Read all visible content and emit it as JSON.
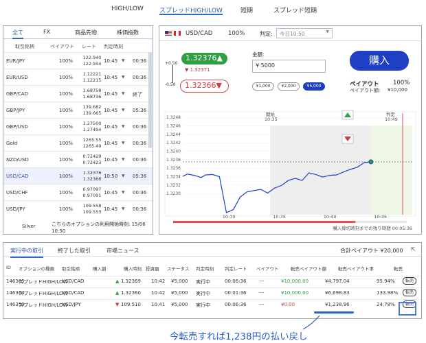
{
  "top_tabs": [
    "HIGH/LOW",
    "スプレッドHIGH/LOW",
    "短期",
    "スプレッド短期"
  ],
  "left": {
    "category_tabs": [
      "全て",
      "FX",
      "商品先物",
      "株価指数"
    ],
    "headers": [
      "取引銘柄",
      "ペイアウト",
      "レート",
      "判定時刻"
    ],
    "rows": [
      {
        "pair": "EUR/JPY",
        "payout": "100%",
        "rate_hi": "122.940",
        "rate_lo": "122.934",
        "judge": "10:45",
        "remain": "00:36"
      },
      {
        "pair": "EUR/USD",
        "payout": "100%",
        "rate_hi": "1.12221",
        "rate_lo": "1.12215",
        "judge": "10:45",
        "remain": "00:36"
      },
      {
        "pair": "GBP/CAD",
        "payout": "100%",
        "rate_hi": "1.68758",
        "rate_lo": "1.68736",
        "judge": "10:45",
        "remain": "終了"
      },
      {
        "pair": "GBP/JPY",
        "payout": "100%",
        "rate_hi": "139.682",
        "rate_lo": "139.665",
        "judge": "10:45",
        "remain": "05:36"
      },
      {
        "pair": "GBP/USD",
        "payout": "100%",
        "rate_hi": "1.27500",
        "rate_lo": "1.27494",
        "judge": "10:45",
        "remain": "00:36"
      },
      {
        "pair": "Gold",
        "payout": "100%",
        "rate_hi": "1265.55",
        "rate_lo": "1265.49",
        "judge": "10:45",
        "remain": "00:36"
      },
      {
        "pair": "NZD/USD",
        "payout": "100%",
        "rate_hi": "0.72429",
        "rate_lo": "0.72423",
        "judge": "10:45",
        "remain": "00:36"
      },
      {
        "pair": "USD/CAD",
        "payout": "100%",
        "rate_hi": "1.32376",
        "rate_lo": "1.32366",
        "judge": "10:50",
        "remain": "05:36"
      },
      {
        "pair": "USD/CHF",
        "payout": "100%",
        "rate_hi": "0.97097",
        "rate_lo": "0.97091",
        "judge": "10:45",
        "remain": "00:36"
      },
      {
        "pair": "USD/JPY",
        "payout": "100%",
        "rate_hi": "109.558",
        "rate_lo": "109.553",
        "judge": "10:45",
        "remain": "00:36"
      }
    ],
    "selected_index": 7,
    "footer_label": "Silver",
    "footer_msg": "こちらのオプションの利用開始時刻: 15/06 10:50"
  },
  "trade": {
    "pair": "USD/CAD",
    "payout_pct": "100%",
    "judge_label": "判定:",
    "judge_select": "今日10:50",
    "high_rate": "1.32376▲",
    "mid_rate": "▼ 1.32371",
    "low_rate": "1.32366▼",
    "scale_top": "+0.50",
    "scale_bottom": "-0.50",
    "amount_label": "金額:",
    "amount_value": "¥ 5000",
    "chips": [
      "¥1,000",
      "¥2,000",
      "¥5,000"
    ],
    "chip_selected": 2,
    "buy_label": "購入",
    "payout_label": "ペイアウト",
    "payout_value": "100%",
    "payout_amount_label": "ペイアウト額:",
    "payout_amount_value": "¥10,000"
  },
  "chart_data": {
    "type": "line",
    "x_ticks": [
      "10:30",
      "10:35",
      "10:40",
      "10:45"
    ],
    "y_ticks": [
      "1.3230",
      "1.3232",
      "1.3234",
      "1.3236",
      "1.3238",
      "1.3240",
      "1.3242",
      "1.3244",
      "1.3246",
      "1.3248"
    ],
    "ylim": [
      1.3225,
      1.3249
    ],
    "start_label": "開始",
    "start_time": "10:35",
    "judge_label": "判定",
    "judge_time": "10:49",
    "progress_fraction": 0.78,
    "remaining_text": "購入締切時刻までの残り時間 00:05:36",
    "series": [
      {
        "x": [
          0,
          0.02,
          0.05,
          0.08,
          0.1,
          0.13,
          0.16,
          0.19,
          0.22,
          0.25,
          0.28,
          0.31,
          0.34,
          0.37,
          0.4,
          0.43,
          0.46,
          0.49,
          0.52,
          0.55,
          0.58,
          0.61,
          0.64,
          0.67,
          0.7,
          0.73,
          0.76,
          0.79,
          0.82
        ],
        "y": [
          1.32341,
          1.32346,
          1.32343,
          1.32338,
          1.32344,
          1.32345,
          1.3234,
          1.32255,
          1.32262,
          1.32292,
          1.32304,
          1.32307,
          1.3231,
          1.32301,
          1.32313,
          1.32319,
          1.32331,
          1.32336,
          1.32331,
          1.32349,
          1.32345,
          1.32339,
          1.32343,
          1.32344,
          1.32351,
          1.32357,
          1.32362,
          1.32373,
          1.32375
        ]
      }
    ]
  },
  "bottom": {
    "tabs": [
      "実行中の取引",
      "終了した取引",
      "市場ニュース"
    ],
    "total_payout": "合計ペイアウト ¥20,000",
    "headers": [
      "ID",
      "オプションの種類",
      "取引銘柄",
      "購入額",
      "購入時刻",
      "投資額",
      "ステータス",
      "判定時刻",
      "判定レート",
      "ペイアウト",
      "転売ペイアウト額",
      "転売ペイアウト率",
      "転売"
    ],
    "rows": [
      {
        "id": "146365",
        "type": "スプレッドHIGH/LOW",
        "pair": "USD/CAD",
        "dir": "up",
        "price": "1.32369",
        "time": "10:42",
        "amount": "¥5,000",
        "status": "実行中",
        "judge": "00:06:36",
        "jrate": "---",
        "payout": "¥10,000.00",
        "resell_amt": "¥4,797.04",
        "resell_pct": "95.94%",
        "btn": "転売"
      },
      {
        "id": "146364",
        "type": "スプレッドHIGH/LOW",
        "pair": "USD/CAD",
        "dir": "up",
        "price": "1.32360",
        "time": "10:42",
        "amount": "¥5,000",
        "status": "実行中",
        "judge": "00:01:36",
        "jrate": "---",
        "payout": "¥10,000.00",
        "resell_amt": "¥6,698.83",
        "resell_pct": "133.98%",
        "btn": "転売"
      },
      {
        "id": "146359",
        "type": "スプレッドHIGH/LOW",
        "pair": "USD/JPY",
        "dir": "down",
        "price": "109.510",
        "time": "10:41",
        "amount": "¥5,000",
        "status": "実行中",
        "judge": "00:06:36",
        "jrate": "---",
        "payout": "¥0.00",
        "resell_amt": "¥1,238.96",
        "resell_pct": "24.78%",
        "btn": "転売"
      }
    ]
  },
  "annotation": "今転売すれば1,238円の払い戻し",
  "colors": {
    "accent": "#2b6fb6",
    "buy": "#1f3fc4",
    "up": "#2ea043",
    "down": "#d23a3a",
    "line": "#1f3fc4"
  }
}
